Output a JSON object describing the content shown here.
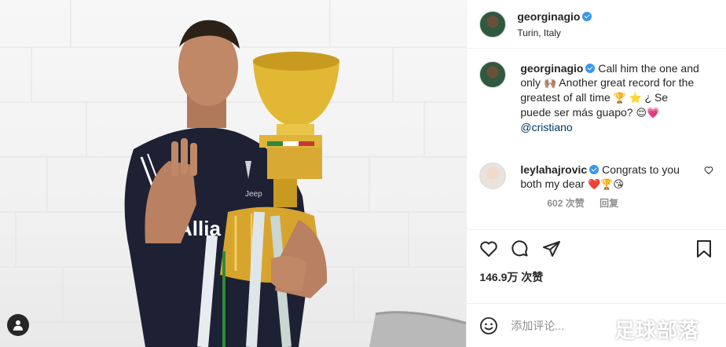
{
  "header": {
    "username": "georginagio",
    "location": "Turin, Italy"
  },
  "caption": {
    "username": "georginagio",
    "text_1": "Call him the one and only",
    "emoji_1": "🙌🏽",
    "text_2": "Another great record for the greatest of all time",
    "emoji_2": "🏆 ⭐",
    "text_3": "¿ Se puede ser más guapo?",
    "emoji_3": "😌💗",
    "mention": "@cristiano"
  },
  "comment": {
    "username": "leylahajrovic",
    "text": "Congrats to you both my dear",
    "emoji": "❤️🏆😘",
    "likes": "602 次赞",
    "reply": "回复"
  },
  "likes_count": "146.9万 次赞",
  "add_comment_placeholder": "添加评论...",
  "watermark": "足球部落",
  "colors": {
    "verified": "#3897f0",
    "mention": "#00376b",
    "muted": "#8e8e8e",
    "text": "#262626"
  },
  "icons": [
    "user-tag-icon",
    "heart-icon",
    "comment-icon",
    "share-icon",
    "bookmark-icon",
    "emoji-icon",
    "verified-icon",
    "small-heart-icon"
  ]
}
